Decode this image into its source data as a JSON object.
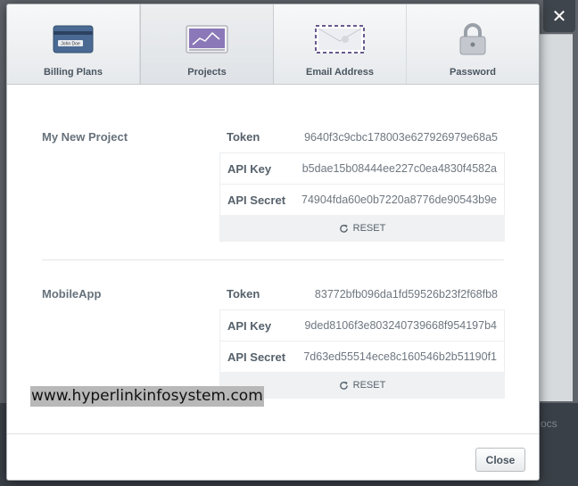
{
  "window": {
    "close_icon": "✕",
    "backdrop_text": "ocs"
  },
  "tabs": [
    {
      "label": "Billing Plans",
      "icon": "credit-card-icon",
      "card_name": "John Doe",
      "active": false
    },
    {
      "label": "Projects",
      "icon": "projects-chart-icon",
      "active": true
    },
    {
      "label": "Email Address",
      "icon": "envelope-icon",
      "active": false
    },
    {
      "label": "Password",
      "icon": "padlock-icon",
      "active": false
    }
  ],
  "projects": [
    {
      "name": "My New Project",
      "token_label": "Token",
      "token": "9640f3c9cbc178003e627926979e68a5",
      "api_key_label": "API Key",
      "api_key": "b5dae15b08444ee227c0ea4830f4582a",
      "api_secret_label": "API Secret",
      "api_secret": "74904fda60e0b7220a8776de90543b9e",
      "reset_label": "RESET"
    },
    {
      "name": "MobileApp",
      "token_label": "Token",
      "token": "83772bfb096da1fd59526b23f2f68fb8",
      "api_key_label": "API Key",
      "api_key": "9ded8106f3e803240739668f954197b4",
      "api_secret_label": "API Secret",
      "api_secret": "7d63ed55514ece8c160546b2b51190f1",
      "reset_label": "RESET"
    }
  ],
  "footer": {
    "close_label": "Close"
  },
  "watermark": "www.hyperlinkinfosystem.com",
  "colors": {
    "accent_purple": "#8a78b8",
    "card_blue": "#4a6a94",
    "label_gray": "#56616b"
  }
}
